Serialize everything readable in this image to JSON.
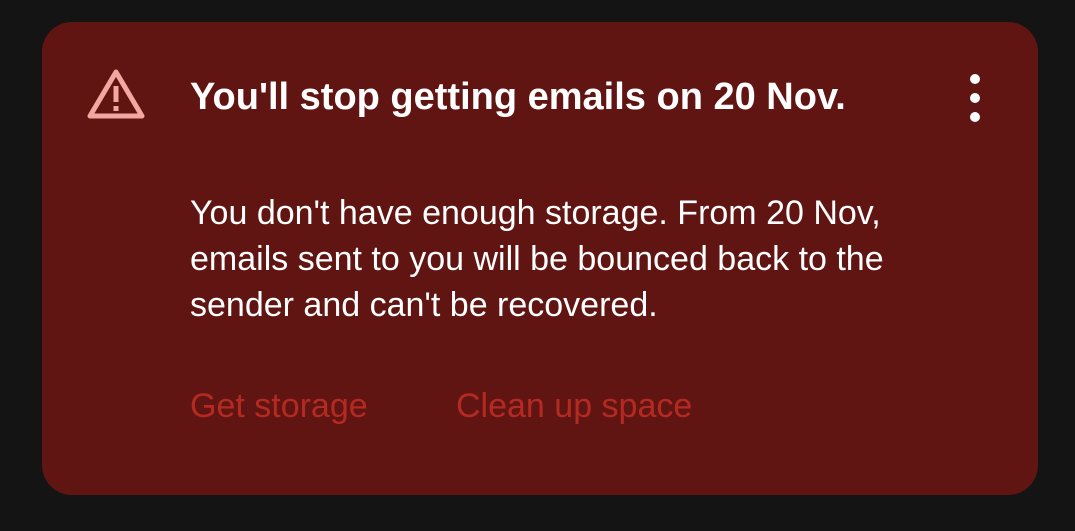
{
  "banner": {
    "title": "You'll stop getting emails on 20 Nov.",
    "body": "You don't have enough storage. From 20 Nov, emails sent to you will be bounced back to the sender and can't be recovered.",
    "icon": "warning-triangle-icon",
    "menu_icon": "more-vert-icon",
    "actions": {
      "get_storage": "Get storage",
      "clean_up": "Clean up space"
    }
  },
  "colors": {
    "page_background": "#141414",
    "card_background": "#611512",
    "icon": "#f4a7a1",
    "text": "#ffffff",
    "action_text": "#b42a22"
  }
}
